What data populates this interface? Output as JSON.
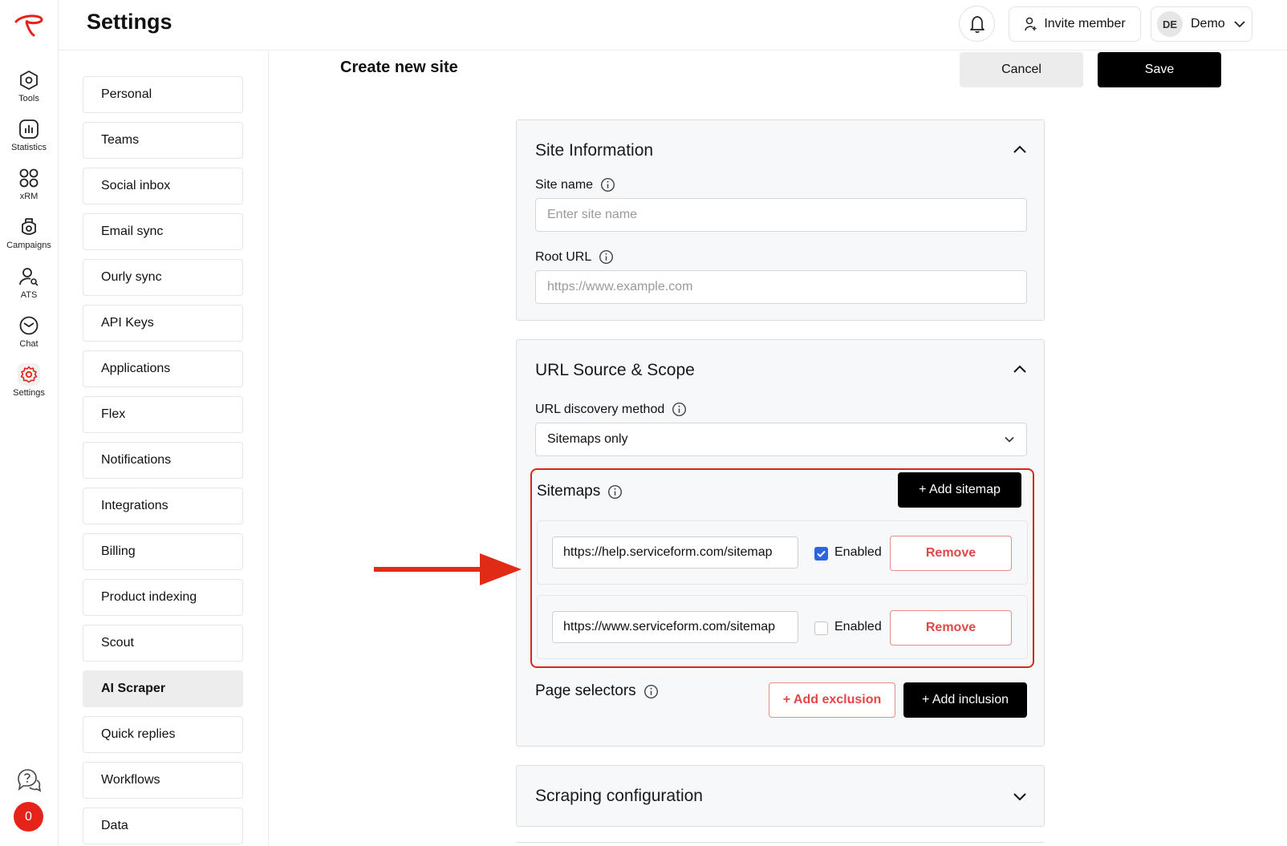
{
  "rail": {
    "items": [
      {
        "label": "Tools"
      },
      {
        "label": "Statistics"
      },
      {
        "label": "xRM"
      },
      {
        "label": "Campaigns"
      },
      {
        "label": "ATS"
      },
      {
        "label": "Chat"
      },
      {
        "label": "Settings"
      }
    ],
    "notification_count": "0",
    "accent": "#e5231b"
  },
  "header": {
    "title": "Settings",
    "invite_label": "Invite member",
    "user_initials": "DE",
    "user_name": "Demo"
  },
  "nav": {
    "items": [
      "Personal",
      "Teams",
      "Social inbox",
      "Email sync",
      "Ourly sync",
      "API Keys",
      "Applications",
      "Flex",
      "Notifications",
      "Integrations",
      "Billing",
      "Product indexing",
      "Scout",
      "AI Scraper",
      "Quick replies",
      "Workflows",
      "Data"
    ],
    "active": "AI Scraper"
  },
  "main": {
    "title": "Create new site",
    "cancel_label": "Cancel",
    "save_label": "Save",
    "site_info": {
      "title": "Site Information",
      "site_name_label": "Site name",
      "site_name_placeholder": "Enter site name",
      "root_url_label": "Root URL",
      "root_url_placeholder": "https://www.example.com"
    },
    "url_source": {
      "title": "URL Source & Scope",
      "discovery_label": "URL discovery method",
      "discovery_value": "Sitemaps only",
      "sitemaps_label": "Sitemaps",
      "add_sitemap_label": "+ Add sitemap",
      "sitemaps": [
        {
          "url": "https://help.serviceform.com/sitemap",
          "enabled": true,
          "enabled_label": "Enabled",
          "remove_label": "Remove"
        },
        {
          "url": "https://www.serviceform.com/sitemap",
          "enabled": false,
          "enabled_label": "Enabled",
          "remove_label": "Remove"
        }
      ],
      "page_selectors_label": "Page selectors",
      "add_exclusion_label": "+ Add exclusion",
      "add_inclusion_label": "+ Add inclusion"
    },
    "scraping_config": {
      "title": "Scraping configuration"
    }
  },
  "colors": {
    "highlight": "#d9261c",
    "primary_button": "#000000",
    "checkbox": "#2b66de"
  }
}
